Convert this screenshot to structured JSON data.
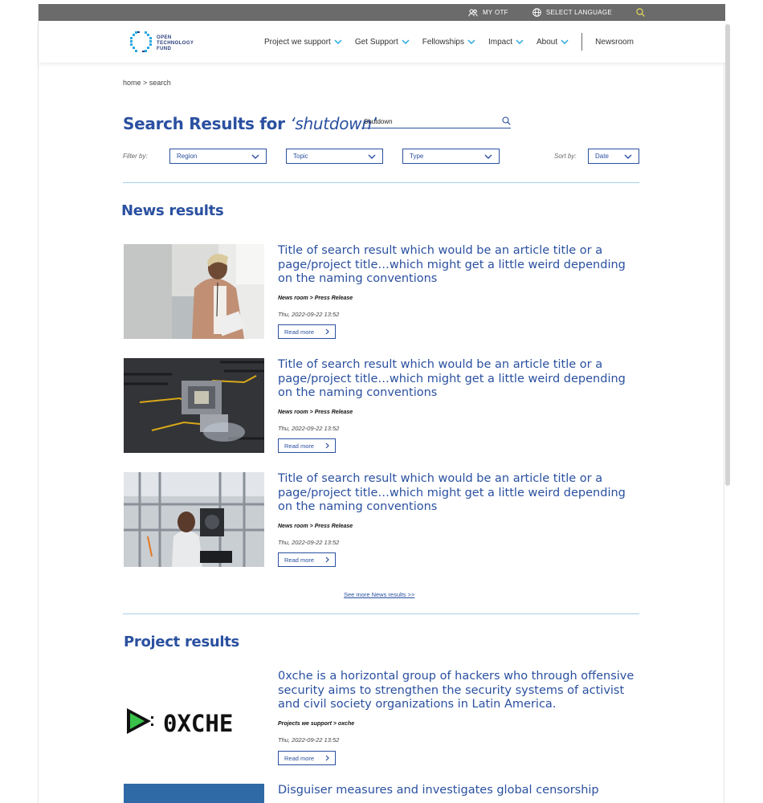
{
  "topbar": {
    "my_otf": "MY OTF",
    "language": "SELECT LANGUAGE"
  },
  "logo": {
    "line1": "OPEN",
    "line2": "TECHNOLOGY",
    "line3": "FUND"
  },
  "nav": {
    "items": [
      {
        "label": "Project we support"
      },
      {
        "label": "Get Support"
      },
      {
        "label": "Fellowships"
      },
      {
        "label": "Impact"
      },
      {
        "label": "About"
      }
    ],
    "newsroom": "Newsroom"
  },
  "breadcrumb": "home > search",
  "search": {
    "title_prefix": "Search Results for ",
    "query": "‘shutdown’",
    "input_value": "Shutdown"
  },
  "filters": {
    "filter_label": "Filter by:",
    "region": "Region",
    "topic": "Topic",
    "type": "Type",
    "sort_label": "Sort by:",
    "sort_value": "Date"
  },
  "news": {
    "heading": "News results",
    "items": [
      {
        "title": "Title of search result which would be an article title or a page/project title…which might get a little weird depending on the naming conventions",
        "crumb": "News room > Press Release",
        "date": "Thu, 2022-09-22 13:52",
        "button": "Read more"
      },
      {
        "title": "Title of search result which would be an article title or a page/project title…which might get a little weird depending on the naming conventions",
        "crumb": "News room > Press Release",
        "date": "Thu, 2022-09-22 13:52",
        "button": "Read more"
      },
      {
        "title": "Title of search result which would be an article title or a page/project title…which might get a little weird depending on the naming conventions",
        "crumb": "News room > Press Release",
        "date": "Thu, 2022-09-22 13:52",
        "button": "Read more"
      }
    ],
    "see_more": "See more News results >>"
  },
  "projects": {
    "heading": "Project results",
    "items": [
      {
        "logo_text": "0XCHE",
        "title": "0xche is a horizontal group of hackers who through offensive security aims to strengthen the security systems of activist and civil society organizations in Latin America.",
        "crumb": "Projects we support > oxche",
        "date": "Thu, 2022-09-22 13:52",
        "button": "Read more"
      },
      {
        "title": "Disguiser measures and investigates global censorship"
      }
    ]
  },
  "colors": {
    "brand_blue": "#2a50a0",
    "topbar_gray": "#6b6b6b",
    "divider": "#a7cfe8",
    "logo_cyan": "#2aa8e0"
  }
}
